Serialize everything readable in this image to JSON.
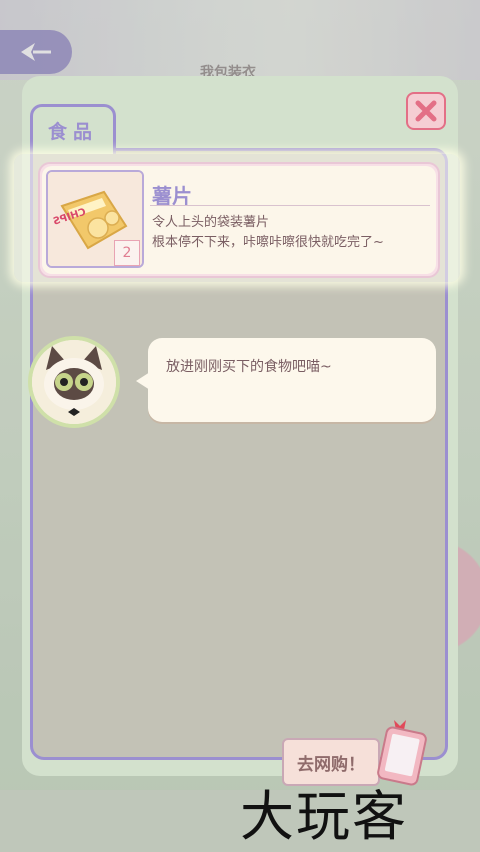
{
  "background": {
    "hidden_title": "我包装衣"
  },
  "panel": {
    "tab_label": "食品",
    "close_icon": "close-icon"
  },
  "item": {
    "name": "薯片",
    "description_line1": "令人上头的袋装薯片",
    "description_line2": "根本停不下来，咔嚓咔嚓很快就吃完了~",
    "count": "2",
    "package_text": "CHIPS"
  },
  "hint": {
    "text": "放进刚刚买下的食物吧喵~"
  },
  "shop": {
    "label": "去网购！"
  },
  "watermark": "大玩客",
  "colors": {
    "accent": "#9b8fd0",
    "close_red": "#e36f86",
    "panel_green": "#d3e1cd",
    "inner_gray": "#c3c2b6"
  }
}
